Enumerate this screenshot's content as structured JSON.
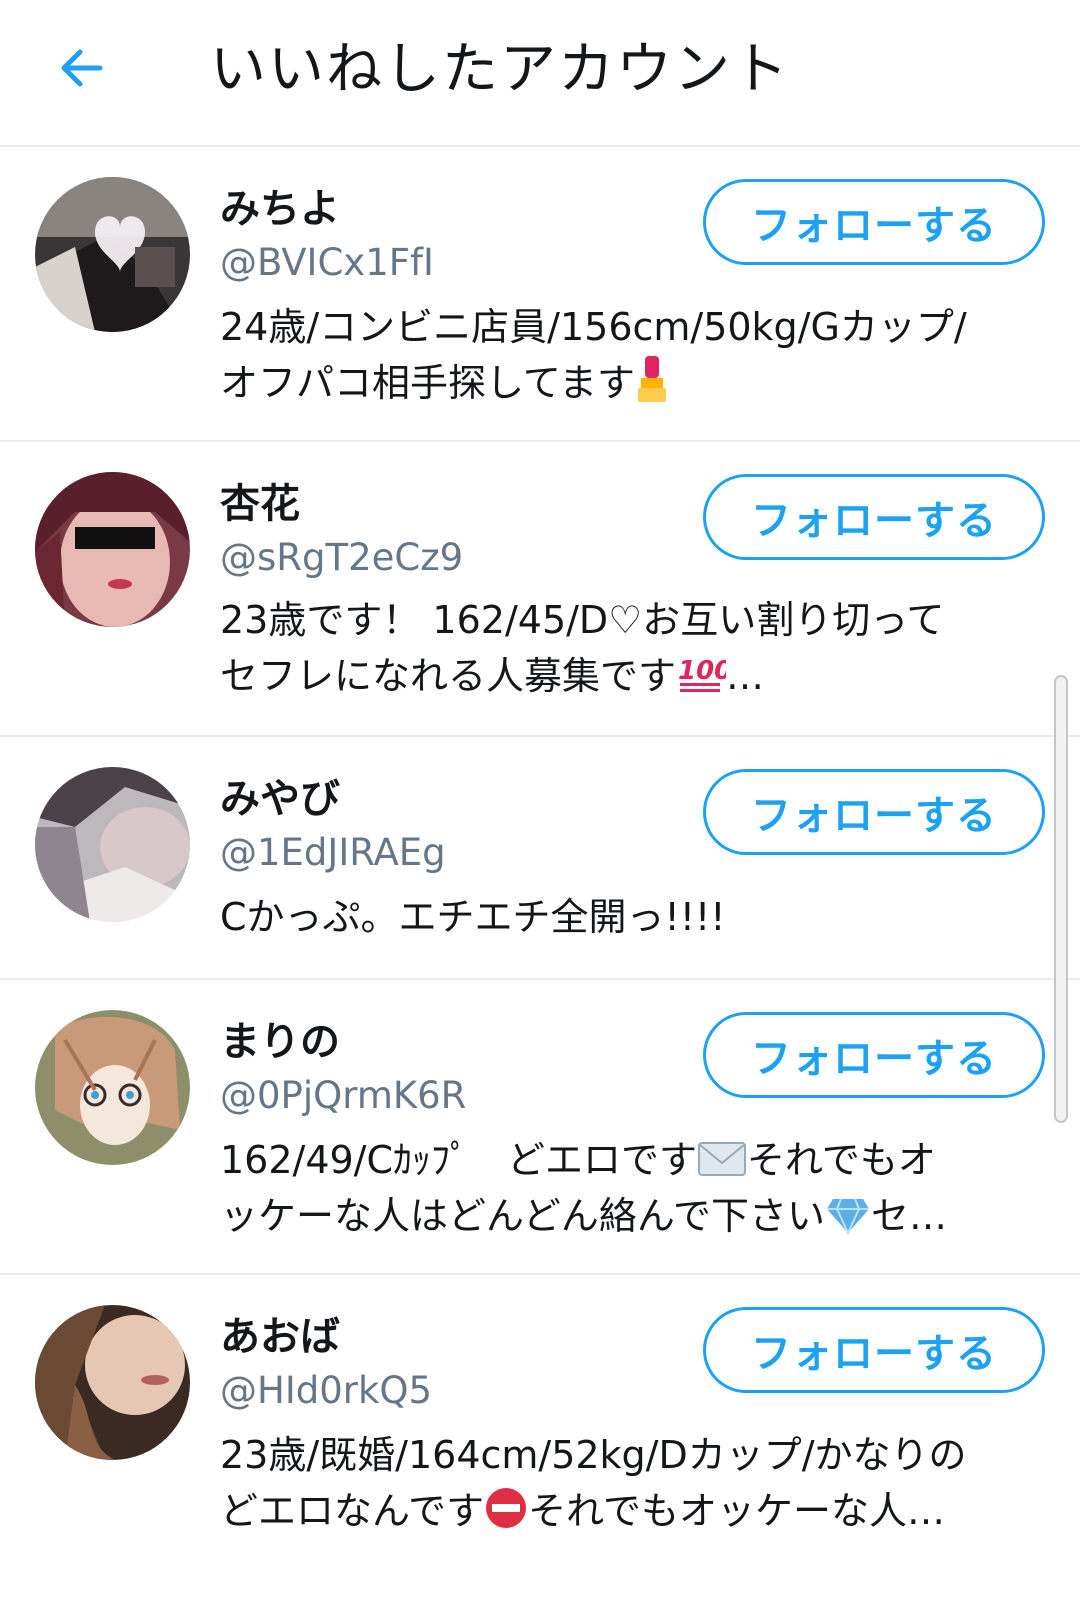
{
  "header": {
    "title": "いいねしたアカウント",
    "back_icon": "arrow-left-icon",
    "accent_color": "#1da1f2"
  },
  "accounts": [
    {
      "name": "みちよ",
      "handle": "@BVICx1FfI",
      "bio_line1": "24歳/コンビニ店員/156cm/50kg/Gカップ/",
      "bio_line2": "オフパコ相手探してます",
      "bio_emoji": "lipstick-icon",
      "follow_label": "フォローする"
    },
    {
      "name": "杏花",
      "handle": "@sRgT2eCz9",
      "bio_line1": "23歳です！ 162/45/D♡お互い割り切って",
      "bio_line2": "セフレになれる人募集です",
      "bio_emoji": "hundred-points-icon",
      "bio_suffix": "…",
      "follow_label": "フォローする"
    },
    {
      "name": "みやび",
      "handle": "@1EdJIRAEg",
      "bio_line1": "Cかっぷ。エチエチ全開っ!!!!",
      "follow_label": "フォローする"
    },
    {
      "name": "まりの",
      "handle": "@0PjQrmK6R",
      "bio_line1a": "162/49/Cｶｯﾌﾟ　どエロです",
      "bio_line1_emoji": "envelope-icon",
      "bio_line1b": "それでもオ",
      "bio_line2a": "ッケーな人はどんどん絡んで下さい",
      "bio_line2_emoji": "gem-icon",
      "bio_line2b": "セ…",
      "follow_label": "フォローする"
    },
    {
      "name": "あおば",
      "handle": "@HId0rkQ5",
      "bio_line1": "23歳/既婚/164cm/52kg/Dカップ/かなりの",
      "bio_line2a": "どエロなんです",
      "bio_line2_emoji": "no-entry-icon",
      "bio_line2b": "それでもオッケーな人…",
      "follow_label": "フォローする"
    }
  ]
}
